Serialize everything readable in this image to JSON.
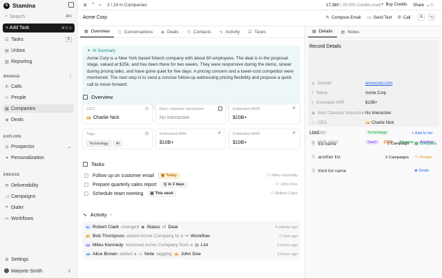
{
  "app": {
    "name": "Stamina"
  },
  "search": {
    "label": "Search",
    "shortcut": "⌘K"
  },
  "add_task": {
    "label": "+ Add Task",
    "shortcut": "⌘ K ⊙"
  },
  "nav_top": [
    {
      "label": "Tasks",
      "count": "5",
      "icon": "check-square-icon"
    },
    {
      "label": "Unbox",
      "icon": "inbox-icon"
    },
    {
      "label": "Reporting",
      "icon": "chart-icon"
    }
  ],
  "sections": {
    "manage": "MANAGE",
    "explore": "EXPLORE",
    "engage": "ENGAGE"
  },
  "nav_manage": [
    {
      "label": "Calls",
      "icon": "phone-icon"
    },
    {
      "label": "People",
      "icon": "person-icon"
    },
    {
      "label": "Companies",
      "icon": "building-icon"
    },
    {
      "label": "Deals",
      "icon": "deal-icon"
    }
  ],
  "nav_explore": [
    {
      "label": "Prospector",
      "icon": "target-icon"
    },
    {
      "label": "Personalization",
      "icon": "sparkle-icon"
    }
  ],
  "nav_engage": [
    {
      "label": "Deliverability",
      "icon": "mail-icon"
    },
    {
      "label": "Campaigns",
      "icon": "megaphone-icon"
    },
    {
      "label": "Dialer",
      "icon": "dialer-icon"
    },
    {
      "label": "Workflows",
      "icon": "workflow-icon"
    }
  ],
  "settings": {
    "label": "Settings"
  },
  "user": {
    "name": "Marjorie Smith"
  },
  "topbar": {
    "pager": "2 / 24 in Companies",
    "credits": "17,380",
    "credits_rest": " / 20,000 Credits used",
    "buy_credits": "Buy Credits",
    "share": "Share"
  },
  "header": {
    "company": "Acme Corp",
    "compose": "Compose Email",
    "send_text": "Send Text",
    "call": "Call"
  },
  "tabs": [
    "Overview",
    "Conversations",
    "Deals",
    "Contacts",
    "Activity",
    "Tasks"
  ],
  "ai_summary": {
    "title": "AI Summary",
    "text": "Acme Corp is a New York based fintech company with about 60 employees. The deal is in the proposal stage, valued at $25k, and has been there for two weeks. They were responsive during the demo, slower during pricing talks, and have gone quiet for five days. A pricing concern and a lower-cost competitor were mentioned. The next step is to send a concise follow-up addressing pricing flexibility and propose a quick call to move forward."
  },
  "overview": {
    "title": "Overview",
    "ceo_label": "CEO",
    "ceo_value": "Charlie Nick",
    "ceo_initials": "CN",
    "next_label": "Next calendar interaction",
    "next_value": "No Interaction",
    "arr_label": "Estimated ARR",
    "arr_value": "$10B+",
    "tags_label": "Tags",
    "tags": [
      "Technology",
      "AI"
    ],
    "arr2_label": "Estimated ARR",
    "arr2_value": "$10B+",
    "arr3_label": "Estimated ARR",
    "arr3_value": "$10B+"
  },
  "tasks": {
    "title": "Tasks",
    "items": [
      {
        "text": "Follow up on customer email",
        "badge": "Today",
        "assignee": "Miles Kennedy"
      },
      {
        "text": "Prepare quarterly sales report",
        "badge": "In 2 days",
        "assignee": "John Doe"
      },
      {
        "text": "Schedule team meeting",
        "badge": "This week",
        "assignee": "Robert Clark"
      }
    ]
  },
  "activity": {
    "title": "Activity",
    "items": [
      {
        "initials": "RC",
        "actor": "Robert Clark",
        "verb": "changed",
        "obj": "Status",
        "prep": "of",
        "target": "Deal",
        "time": "4 minute ago"
      },
      {
        "initials": "BT",
        "actor": "Bob Thompson",
        "verb": "added Acme Company to a",
        "obj": "",
        "prep": "",
        "target": "Workflow",
        "time": "1 hour ago"
      },
      {
        "initials": "MK",
        "actor": "Miles Kennedy",
        "verb": "removed Acme Company from a",
        "obj": "",
        "prep": "",
        "target": "List",
        "time": "2 hours ago"
      },
      {
        "initials": "AB",
        "actor": "Alice Brown",
        "verb": "added a",
        "obj": "Note",
        "prep": "tagging",
        "target": "John Doe",
        "target_initials": "JD",
        "time": "3 hours ago"
      }
    ]
  },
  "right_tabs": [
    "Details",
    "Notes"
  ],
  "record": {
    "title": "Record Details",
    "rows": [
      {
        "k": "Domain",
        "v": "acmecorp.com"
      },
      {
        "k": "Name",
        "v": "Acme Corp"
      },
      {
        "k": "Estimated ARR",
        "v": "$10B+"
      },
      {
        "k": "Next Calendar Interaction",
        "v": "No Interaction"
      },
      {
        "k": "CEO",
        "v": "Charlie Nick",
        "initials": "CN"
      },
      {
        "k": "Tags",
        "v": "Technology"
      },
      {
        "k": "Multi select",
        "v": ""
      }
    ],
    "multi": [
      "SaaS",
      "CRM",
      "Finance",
      "Another"
    ]
  },
  "lists": {
    "title": "Lists",
    "add": "+ Add to list",
    "items": [
      {
        "name": "list-name",
        "count": "1 Campaign",
        "type": "Company"
      },
      {
        "name": "another list",
        "count": "2 Campaigns",
        "type": "People"
      },
      {
        "name": "third list name",
        "count": "",
        "type": "Deals"
      }
    ]
  },
  "colors": {
    "accent": "#2563eb",
    "ai_bg": "#eef7f7",
    "green": "#16a34a",
    "orange": "#ea8a0c"
  }
}
